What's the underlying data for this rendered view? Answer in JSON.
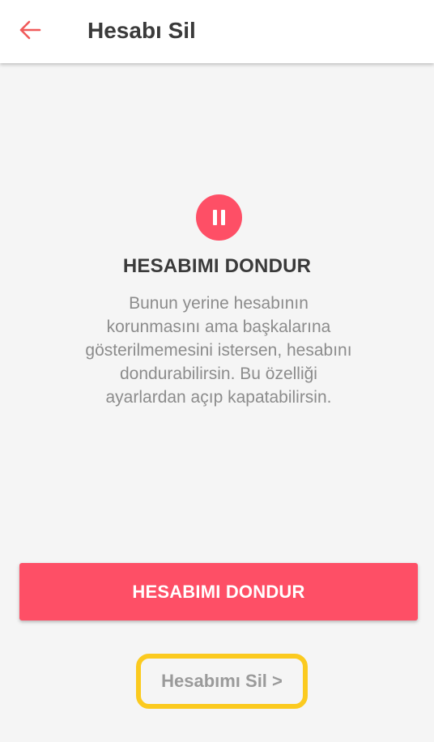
{
  "header": {
    "back_icon": "arrow-left-icon",
    "title": "Hesabı Sil"
  },
  "main": {
    "icon": "pause-icon",
    "heading": "HESABIMI DONDUR",
    "description": "Bunun yerine hesabının korunmasını ama başkalarına gösterilmemesini istersen, hesabını dondurabilirsin. Bu özelliği ayarlardan açıp kapatabilirsin.",
    "primary_button_label": "HESABIMI DONDUR",
    "delete_link_label": "Hesabımı Sil >"
  },
  "colors": {
    "accent": "#fe4f66",
    "highlight": "#fbca1f",
    "background": "#f5f5f5"
  }
}
